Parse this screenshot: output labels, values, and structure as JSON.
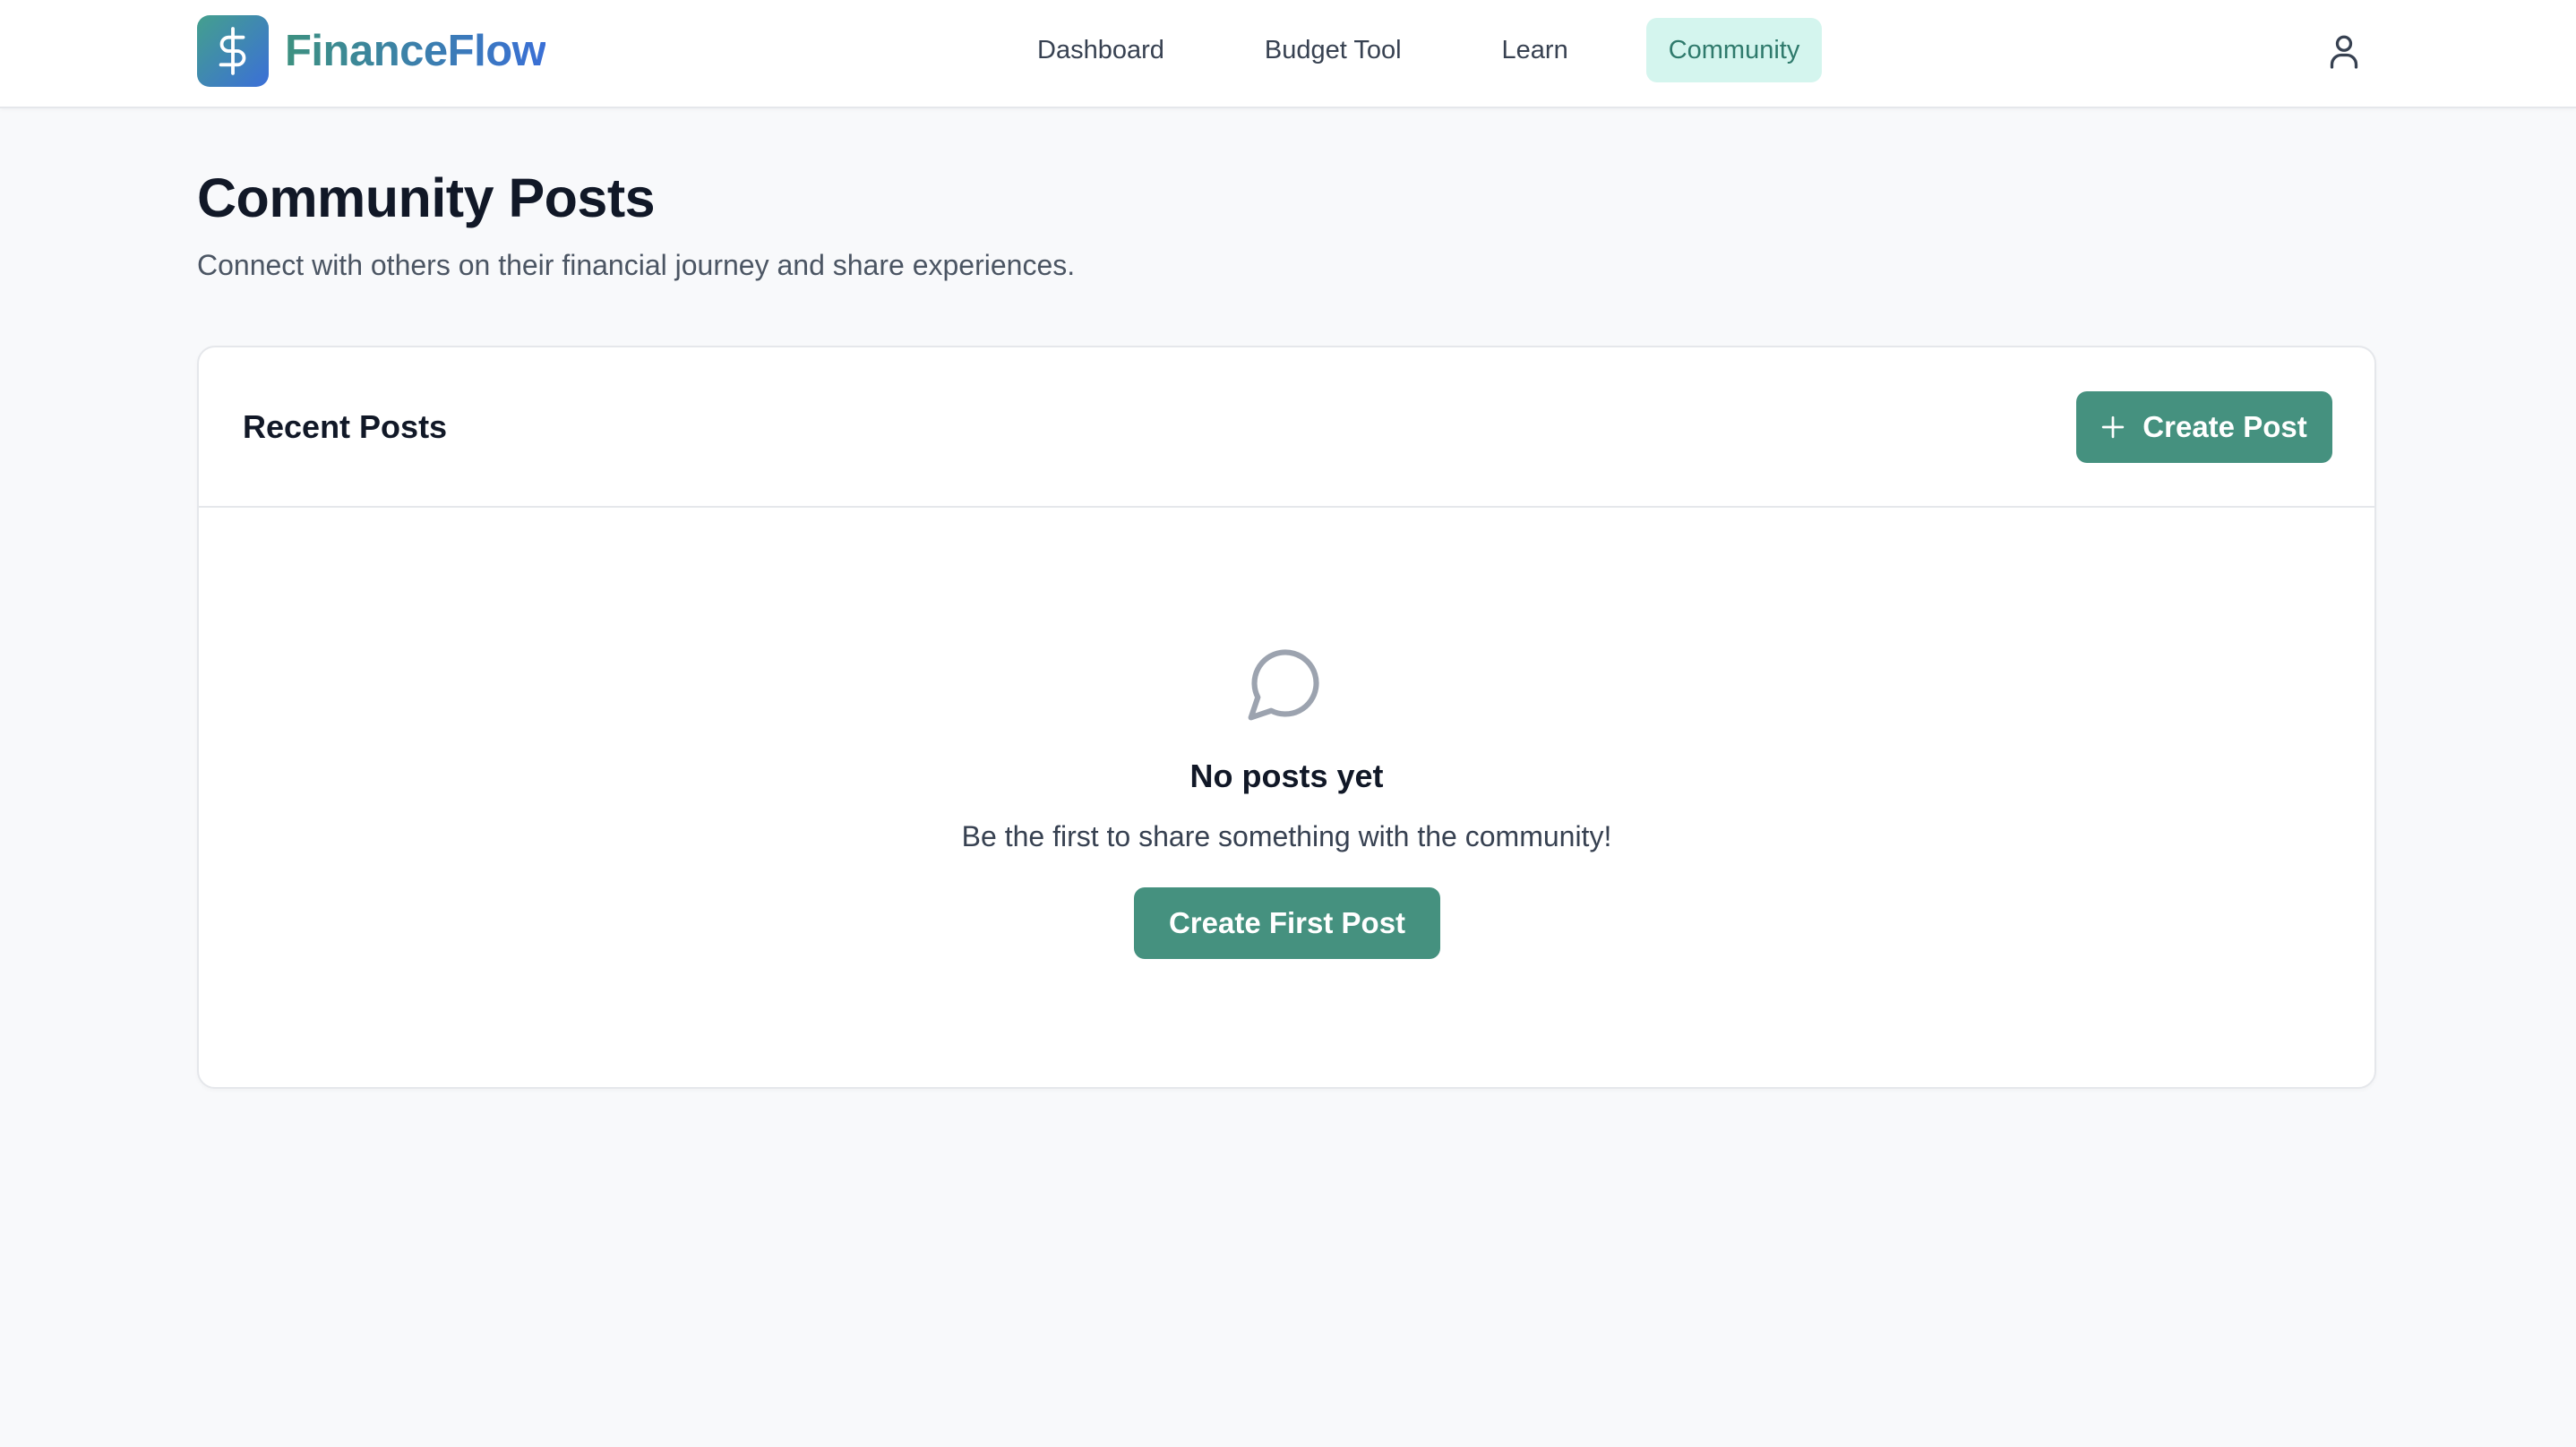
{
  "brand": {
    "name": "FinanceFlow",
    "logo_icon": "dollar-icon"
  },
  "nav": {
    "items": [
      {
        "label": "Dashboard",
        "active": false
      },
      {
        "label": "Budget Tool",
        "active": false
      },
      {
        "label": "Learn",
        "active": false
      },
      {
        "label": "Community",
        "active": true
      }
    ],
    "user_icon": "user-icon"
  },
  "page": {
    "title": "Community Posts",
    "subtitle": "Connect with others on their financial journey and share experiences."
  },
  "card": {
    "title": "Recent Posts",
    "create_label": "Create Post",
    "create_icon": "plus-icon",
    "empty": {
      "icon": "message-circle-icon",
      "title": "No posts yet",
      "text": "Be the first to share something with the community!",
      "button_label": "Create First Post"
    }
  },
  "colors": {
    "accent": "#45917f",
    "active_nav_bg": "#d4f5ee",
    "active_nav_text": "#2f7a6c",
    "page_bg": "#f8f9fb"
  }
}
